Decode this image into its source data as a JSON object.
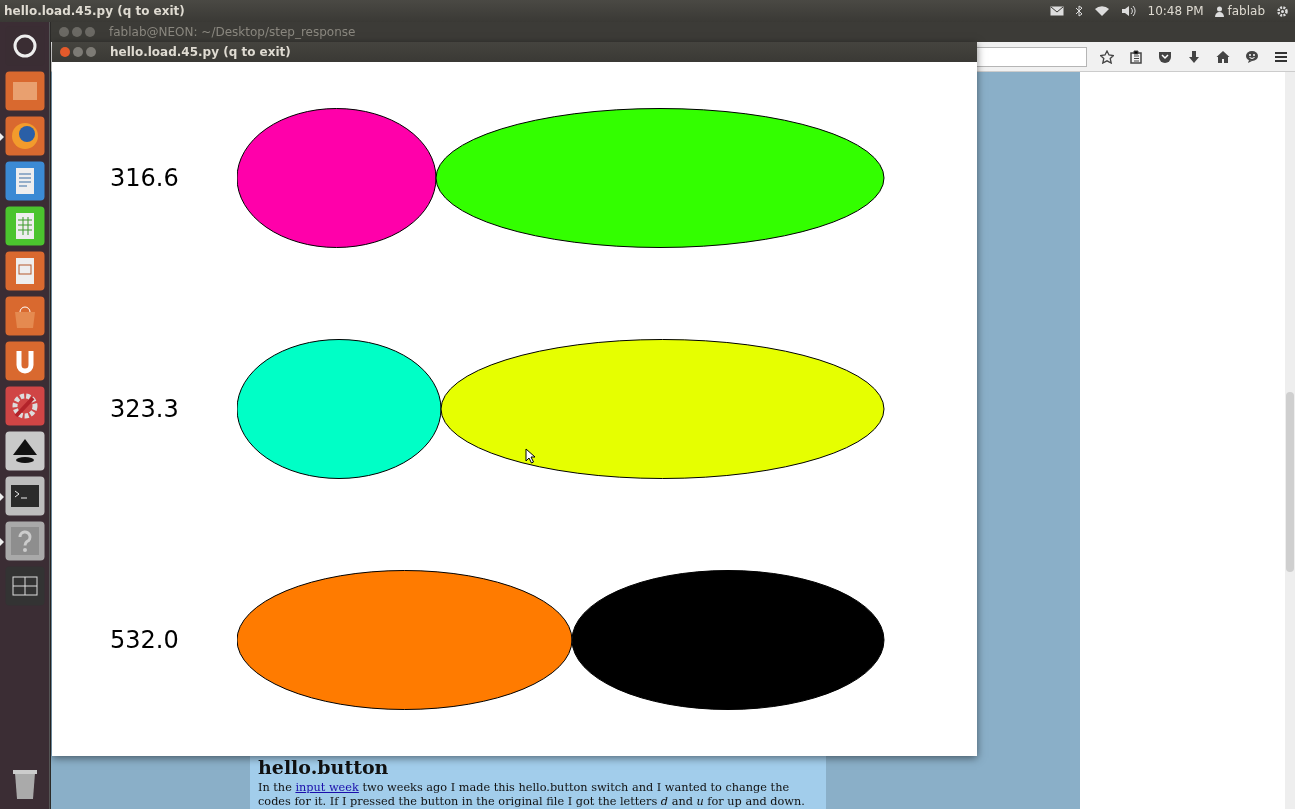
{
  "top_panel": {
    "title": "hello.load.45.py (q to exit)",
    "clock": "10:48 PM",
    "user": "fablab"
  },
  "launcher": {
    "items": [
      {
        "kind": "home",
        "running": false
      },
      {
        "kind": "files",
        "running": false
      },
      {
        "kind": "firefox",
        "running": true
      },
      {
        "kind": "writer",
        "running": false
      },
      {
        "kind": "calc",
        "running": false
      },
      {
        "kind": "impress",
        "running": false
      },
      {
        "kind": "store",
        "running": false
      },
      {
        "kind": "ubuntu-one",
        "running": false
      },
      {
        "kind": "settings",
        "running": false
      },
      {
        "kind": "inkscape",
        "running": false
      },
      {
        "kind": "terminal",
        "running": true
      },
      {
        "kind": "help",
        "running": true
      },
      {
        "kind": "workspaces",
        "running": false
      }
    ]
  },
  "terminal_window": {
    "title": "fablab@NEON: ~/Desktop/step_response"
  },
  "browser": {
    "page": {
      "heading": "hello.button",
      "paragraph_before_link": "In the ",
      "link": "input week",
      "paragraph_after_link": " two weeks ago I made this hello.button switch and I wanted to change the codes for it. If I pressed the button in the original file I got the letters *d* and *u* for up and down."
    }
  },
  "plot_window": {
    "title": "hello.load.45.py (q to exit)",
    "rows": [
      {
        "reading": "316.6",
        "ellipses": [
          {
            "color": "#ff00aa"
          },
          {
            "color": "#33ff00"
          }
        ]
      },
      {
        "reading": "323.3",
        "ellipses": [
          {
            "color": "#00ffc6"
          },
          {
            "color": "#e6ff00"
          }
        ]
      },
      {
        "reading": "532.0",
        "ellipses": [
          {
            "color": "#ff7b00"
          },
          {
            "color": "#000000"
          }
        ]
      }
    ]
  }
}
